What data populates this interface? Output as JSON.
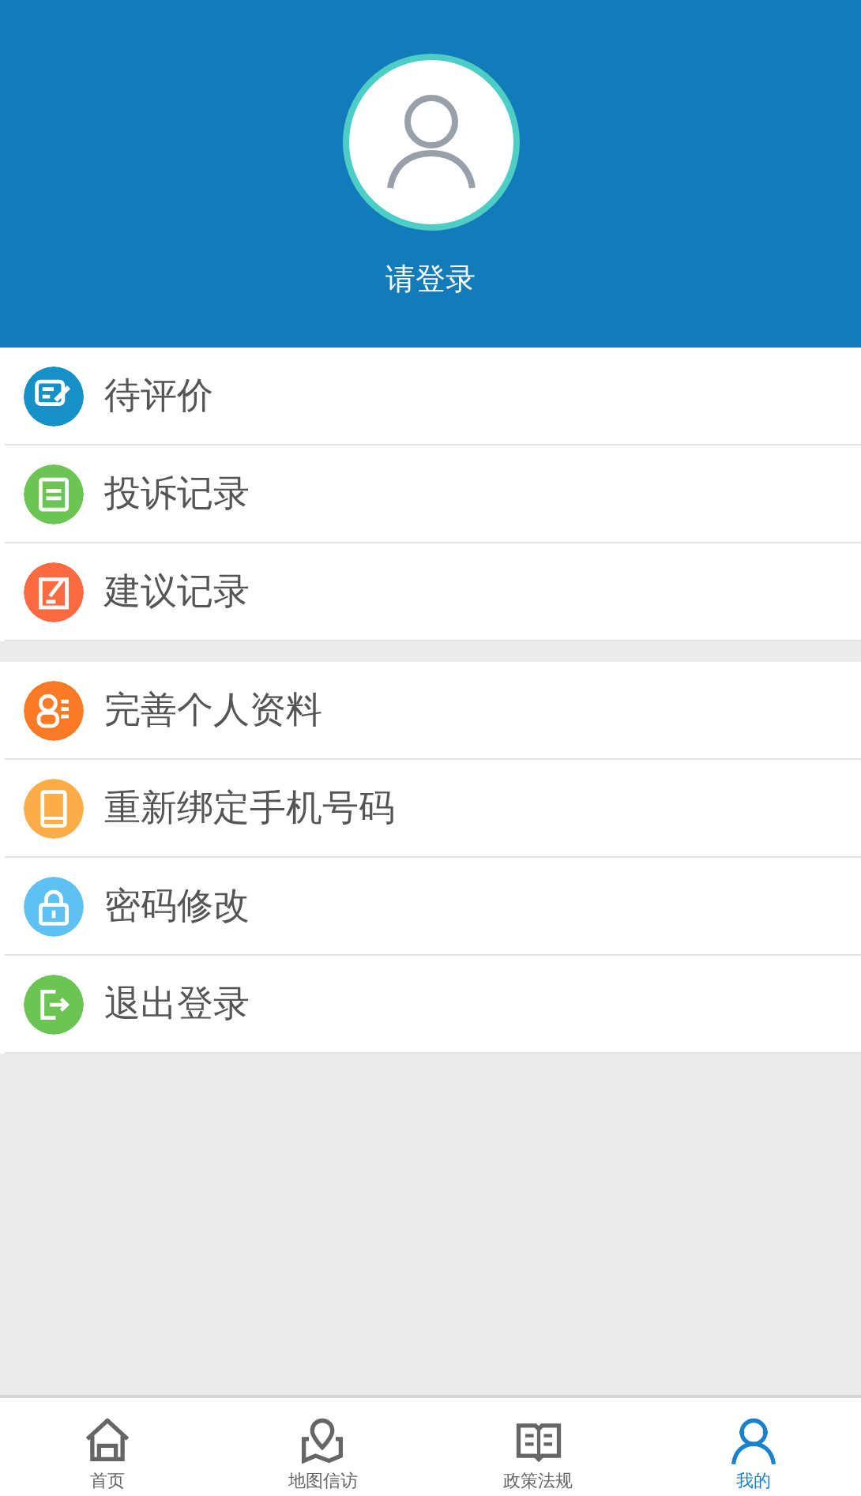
{
  "header": {
    "login_label": "请登录"
  },
  "menu_groups": [
    {
      "items": [
        {
          "label": "待评价",
          "kind": "pen",
          "color": "#1591c8"
        },
        {
          "label": "投诉记录",
          "kind": "list",
          "color": "#6cc454"
        },
        {
          "label": "建议记录",
          "kind": "edit",
          "color": "#fb6a40"
        }
      ]
    },
    {
      "items": [
        {
          "label": "完善个人资料",
          "kind": "profile",
          "color": "#fb7a25"
        },
        {
          "label": "重新绑定手机号码",
          "kind": "phone",
          "color": "#fdad47"
        },
        {
          "label": "密码修改",
          "kind": "lock",
          "color": "#5ec1f3"
        },
        {
          "label": "退出登录",
          "kind": "logout",
          "color": "#6cc454"
        }
      ]
    }
  ],
  "tab_bar": [
    {
      "label": "首页",
      "kind": "home",
      "selected": false
    },
    {
      "label": "地图信访",
      "kind": "map",
      "selected": false
    },
    {
      "label": "政策法规",
      "kind": "book",
      "selected": false
    },
    {
      "label": "我的",
      "kind": "person",
      "selected": true
    }
  ]
}
